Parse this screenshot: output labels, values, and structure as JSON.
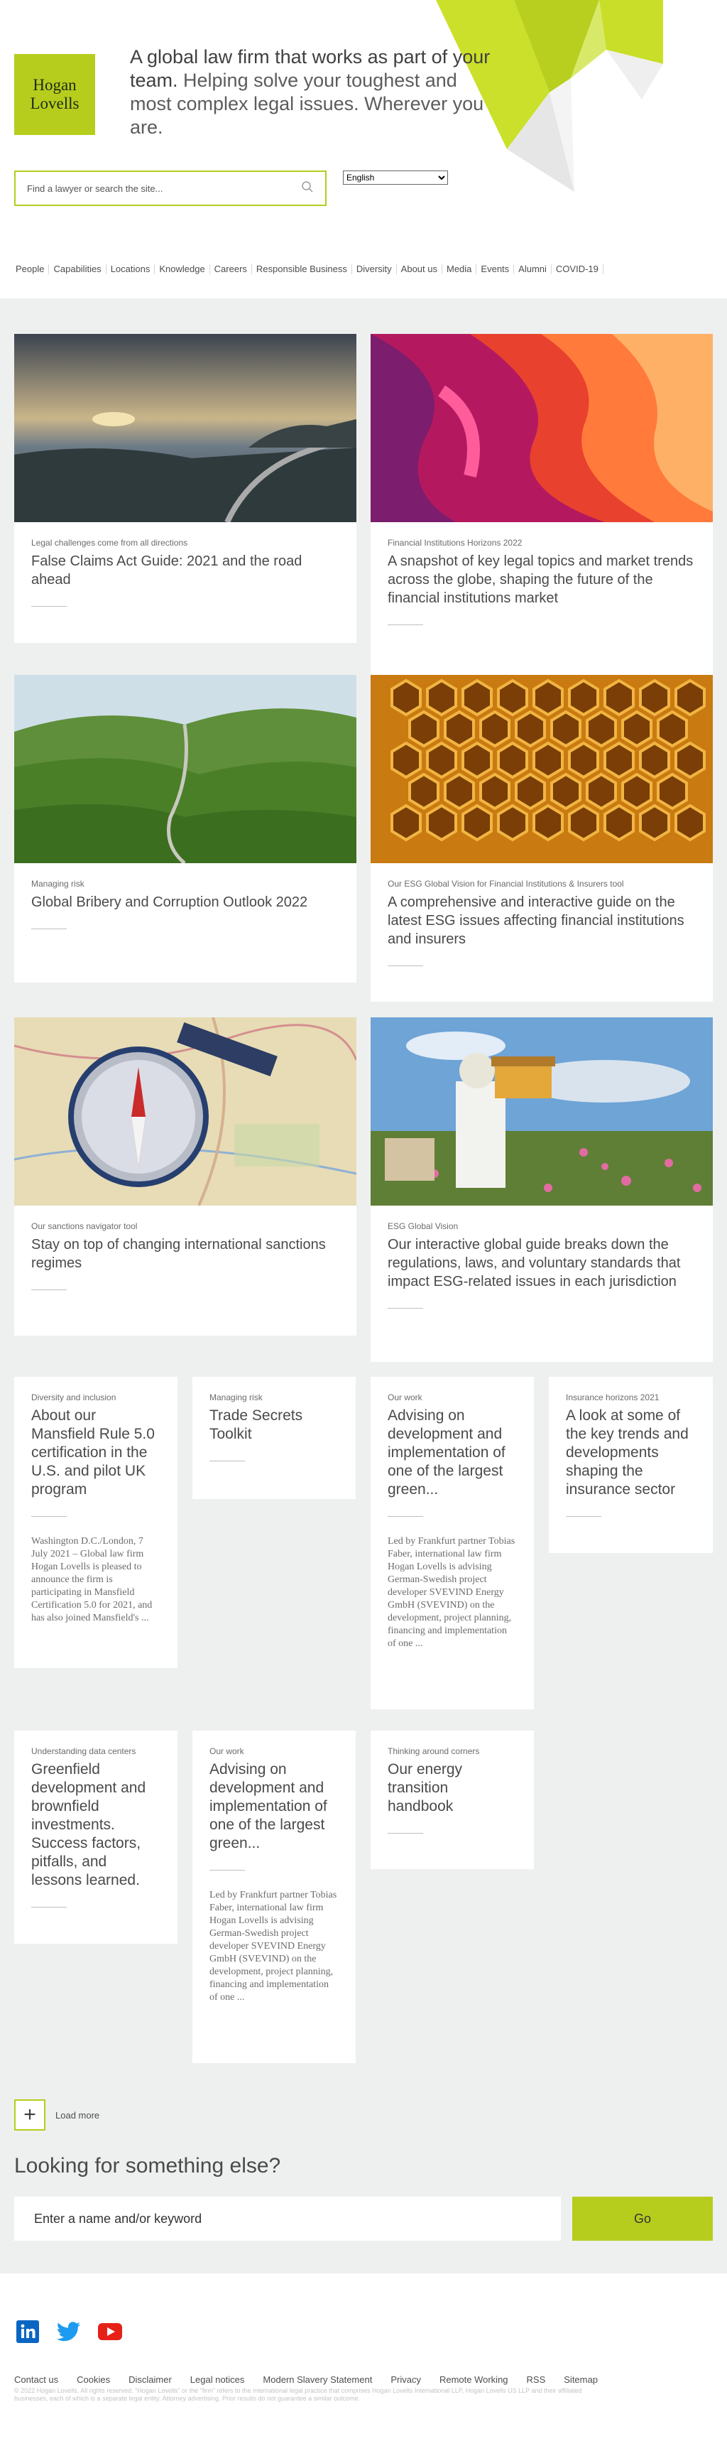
{
  "brand": {
    "logo_line1": "Hogan",
    "logo_line2": "Lovells",
    "accent": "#b6cd1d"
  },
  "tagline": {
    "strong": "A global law firm that works as part of your team.",
    "rest": " Helping solve your toughest and most complex legal issues. Wherever you are."
  },
  "search": {
    "placeholder": "Find a lawyer or search the site..."
  },
  "language": {
    "selected": "English"
  },
  "nav": [
    "People",
    "Capabilities",
    "Locations",
    "Knowledge",
    "Careers",
    "Responsible Business",
    "Diversity",
    "About us",
    "Media",
    "Events",
    "Alumni",
    "COVID-19"
  ],
  "cards": [
    {
      "eyebrow": "Legal challenges come from all directions",
      "title": "False Claims Act Guide: 2021 and the road ahead"
    },
    {
      "eyebrow": "Financial Institutions Horizons 2022",
      "title": "A snapshot of key legal topics and market trends across the globe, shaping the future of the financial institutions market"
    },
    {
      "eyebrow": "Managing risk",
      "title": "Global Bribery and Corruption Outlook 2022"
    },
    {
      "eyebrow": "Our ESG Global Vision for Financial Institutions & Insurers tool",
      "title": "A comprehensive and interactive guide on the latest ESG issues affecting financial institutions and insurers"
    },
    {
      "eyebrow": "Our sanctions navigator tool",
      "title": "Stay on top of changing international sanctions regimes"
    },
    {
      "eyebrow": "ESG Global Vision",
      "title": "Our interactive global guide breaks down the regulations, laws, and voluntary standards that impact ESG-related issues in each jurisdiction"
    }
  ],
  "small_cards": [
    {
      "eyebrow": "Diversity and inclusion",
      "title": "About our Mansfield Rule 5.0 certification in the U.S. and pilot UK program",
      "excerpt": "Washington D.C./London, 7 July 2021 – Global law firm Hogan Lovells is pleased to announce the firm is participating in Mansfield Certification 5.0 for 2021, and has also joined Mansfield's ..."
    },
    {
      "eyebrow": "Managing risk",
      "title": "Trade Secrets Toolkit",
      "excerpt": ""
    },
    {
      "eyebrow": "Our work",
      "title": "Advising on development and implementation of one of the largest green...",
      "excerpt": "Led by Frankfurt partner Tobias Faber, international law firm Hogan Lovells is advising German-Swedish project developer SVEVIND Energy GmbH (SVEVIND) on the development, project planning, financing and implementation of one ..."
    },
    {
      "eyebrow": "Insurance horizons 2021",
      "title": "A look at some of the key trends and developments shaping the insurance sector",
      "excerpt": ""
    },
    {
      "eyebrow": "Understanding data centers",
      "title": "Greenfield development and brownfield investments. Success factors, pitfalls, and lessons learned.",
      "excerpt": ""
    },
    {
      "eyebrow": "Our work",
      "title": "Advising on development and implementation of one of the largest green...",
      "excerpt": "Led by Frankfurt partner Tobias Faber, international law firm Hogan Lovells is advising German-Swedish project developer SVEVIND Energy GmbH (SVEVIND) on the development, project planning, financing and implementation of one ..."
    },
    {
      "eyebrow": "Thinking around corners",
      "title": "Our energy transition handbook",
      "excerpt": ""
    }
  ],
  "load_more": {
    "label": "Load more"
  },
  "search_more": {
    "heading": "Looking for something else?",
    "placeholder": "Enter a name and/or keyword",
    "button": "Go"
  },
  "social": [
    "linkedin-icon",
    "twitter-icon",
    "youtube-icon"
  ],
  "footer_links": [
    "Contact us",
    "Cookies",
    "Disclaimer",
    "Legal notices",
    "Modern Slavery Statement",
    "Privacy",
    "Remote Working",
    "RSS",
    "Sitemap"
  ],
  "legal": "© 2022 Hogan Lovells. All rights reserved. \"Hogan Lovells\" or the \"firm\" refers to the international legal practice that comprises Hogan Lovells International LLP, Hogan Lovells US LLP and their affiliated businesses, each of which is a separate legal entity. Attorney advertising. Prior results do not guarantee a similar outcome."
}
